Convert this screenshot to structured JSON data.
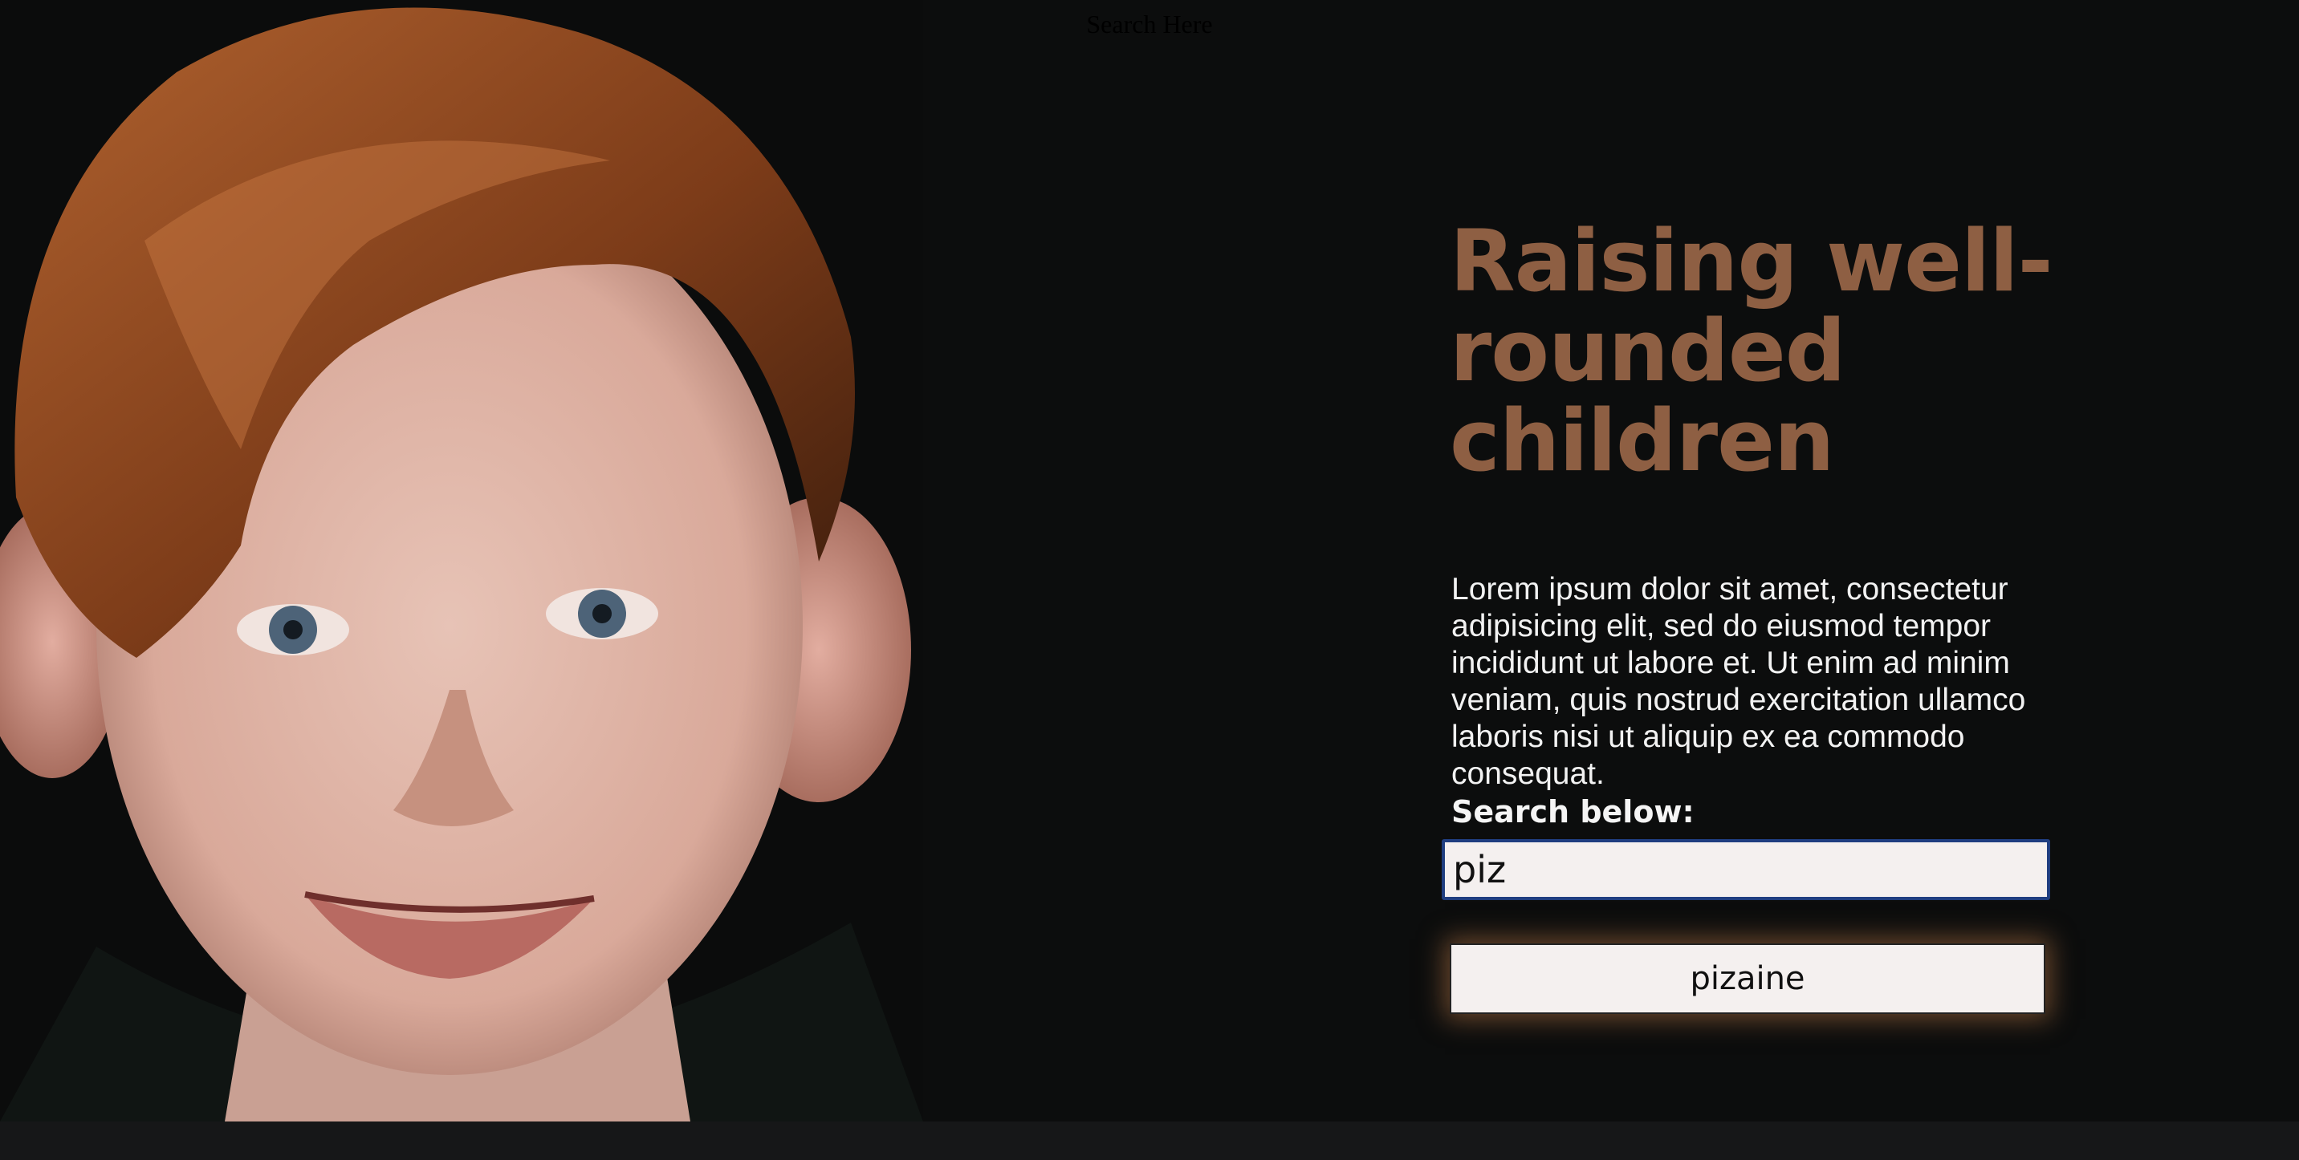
{
  "page": {
    "title": "Search Here"
  },
  "hero": {
    "headline": "Raising well-rounded children",
    "body": "Lorem ipsum dolor sit amet, consectetur adipisicing elit, sed do eiusmod tempor incididunt ut labore et. Ut enim ad minim veniam, quis nostrud exercitation ullamco laboris nisi ut aliquip ex ea commodo consequat."
  },
  "search": {
    "label": "Search below:",
    "value": "piz",
    "suggestion_label": "pizaine"
  },
  "colors": {
    "accent": "#8e5f43",
    "background": "#0c0d0d",
    "input_border": "#1f3e80"
  }
}
